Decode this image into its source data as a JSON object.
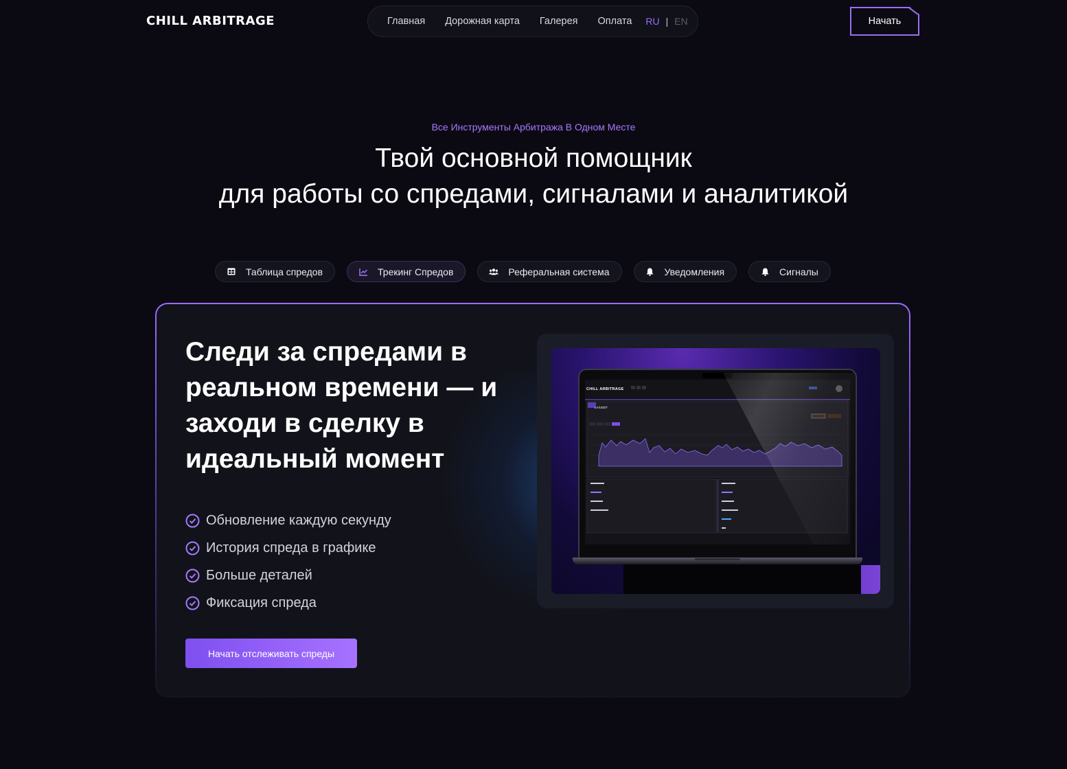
{
  "header": {
    "logo": "CHILL ARBITRAGE",
    "nav": [
      "Главная",
      "Дорожная карта",
      "Галерея",
      "Оплата"
    ],
    "lang_ru": "RU",
    "lang_sep": "|",
    "lang_en": "EN",
    "start_label": "Начать"
  },
  "hero": {
    "eyebrow": "Все Инструменты Арбитража В Одном Месте",
    "headline_line1": "Твой основной помощник",
    "headline_line2": "для работы со спредами, сигналами и аналитикой"
  },
  "tabs": [
    {
      "label": "Таблица спредов",
      "icon": "table-icon"
    },
    {
      "label": "Трекинг Спредов",
      "icon": "chart-line-icon"
    },
    {
      "label": "Реферальная система",
      "icon": "users-icon"
    },
    {
      "label": "Уведомления",
      "icon": "bell-icon"
    },
    {
      "label": "Сигналы",
      "icon": "bell-icon"
    }
  ],
  "active_tab": "Трекинг Спредов",
  "feature": {
    "title": "Следи за спредами в реальном времени — и заходи в сделку в идеальный момент",
    "items": [
      "Обновление каждую секунду",
      "История спреда в графике",
      "Больше деталей",
      "Фиксация спреда"
    ],
    "cta": "Начать отслеживать спреды"
  },
  "mockup": {
    "logo": "CHILL ARBITRAGE",
    "pair": "LA/USDT"
  },
  "colors": {
    "accent": "#9b6bff",
    "background": "#0b0a13",
    "card": "#12131a"
  }
}
